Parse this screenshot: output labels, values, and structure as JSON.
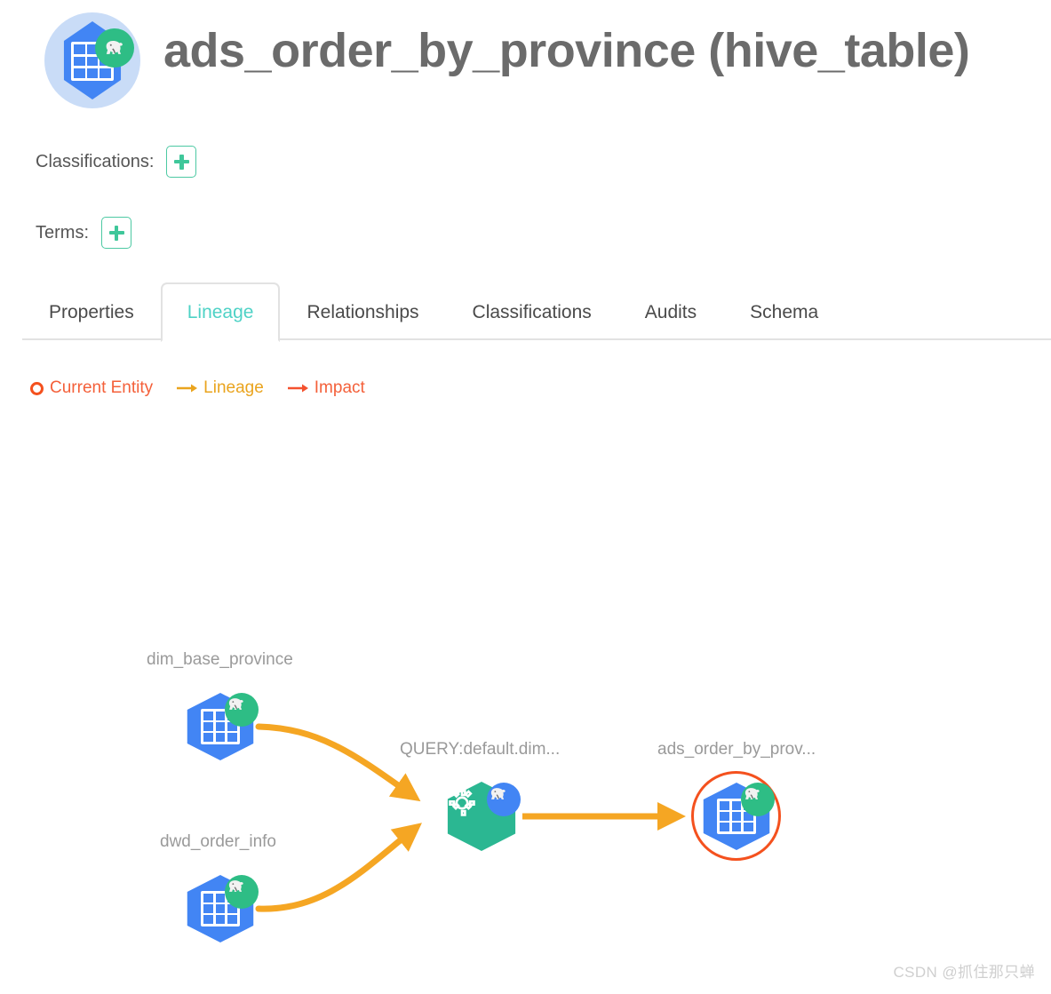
{
  "header": {
    "title": "ads_order_by_province (hive_table)",
    "logo_icon": "hive-table-icon",
    "logo_badge_icon": "hadoop-elephant-icon"
  },
  "meta": {
    "classifications_label": "Classifications:",
    "classifications_add_icon": "plus-icon",
    "terms_label": "Terms:",
    "terms_add_icon": "plus-icon"
  },
  "tabs": {
    "active": "Lineage",
    "items": [
      {
        "label": "Properties"
      },
      {
        "label": "Lineage"
      },
      {
        "label": "Relationships"
      },
      {
        "label": "Classifications"
      },
      {
        "label": "Audits"
      },
      {
        "label": "Schema"
      }
    ]
  },
  "legend": {
    "items": [
      {
        "label": "Current Entity",
        "icon": "circle-outline-icon",
        "color": "#f4603a"
      },
      {
        "label": "Lineage",
        "icon": "arrow-right-icon",
        "color": "#eaa41e"
      },
      {
        "label": "Impact",
        "icon": "arrow-right-icon",
        "color": "#f4603a"
      }
    ]
  },
  "lineage_graph": {
    "edge_color": "#f5a623",
    "current_entity_ring_color": "#f4511e",
    "nodes": [
      {
        "id": "dim_base_province",
        "label": "dim_base_province",
        "type": "hive_table",
        "icon": "hive-table-icon",
        "badge_icon": "hadoop-elephant-icon",
        "is_current": false
      },
      {
        "id": "dwd_order_info",
        "label": "dwd_order_info",
        "type": "hive_table",
        "icon": "hive-table-icon",
        "badge_icon": "hadoop-elephant-icon",
        "is_current": false
      },
      {
        "id": "query_default_dim",
        "label": "QUERY:default.dim...",
        "type": "hive_process",
        "icon": "gear-icon",
        "badge_icon": "hadoop-elephant-icon",
        "is_current": false
      },
      {
        "id": "ads_order_by_province",
        "label": "ads_order_by_prov...",
        "type": "hive_table",
        "icon": "hive-table-icon",
        "badge_icon": "hadoop-elephant-icon",
        "is_current": true
      }
    ],
    "edges": [
      {
        "from": "dim_base_province",
        "to": "query_default_dim"
      },
      {
        "from": "dwd_order_info",
        "to": "query_default_dim"
      },
      {
        "from": "query_default_dim",
        "to": "ads_order_by_province"
      }
    ]
  },
  "watermark": {
    "text": "CSDN @抓住那只蝉"
  }
}
